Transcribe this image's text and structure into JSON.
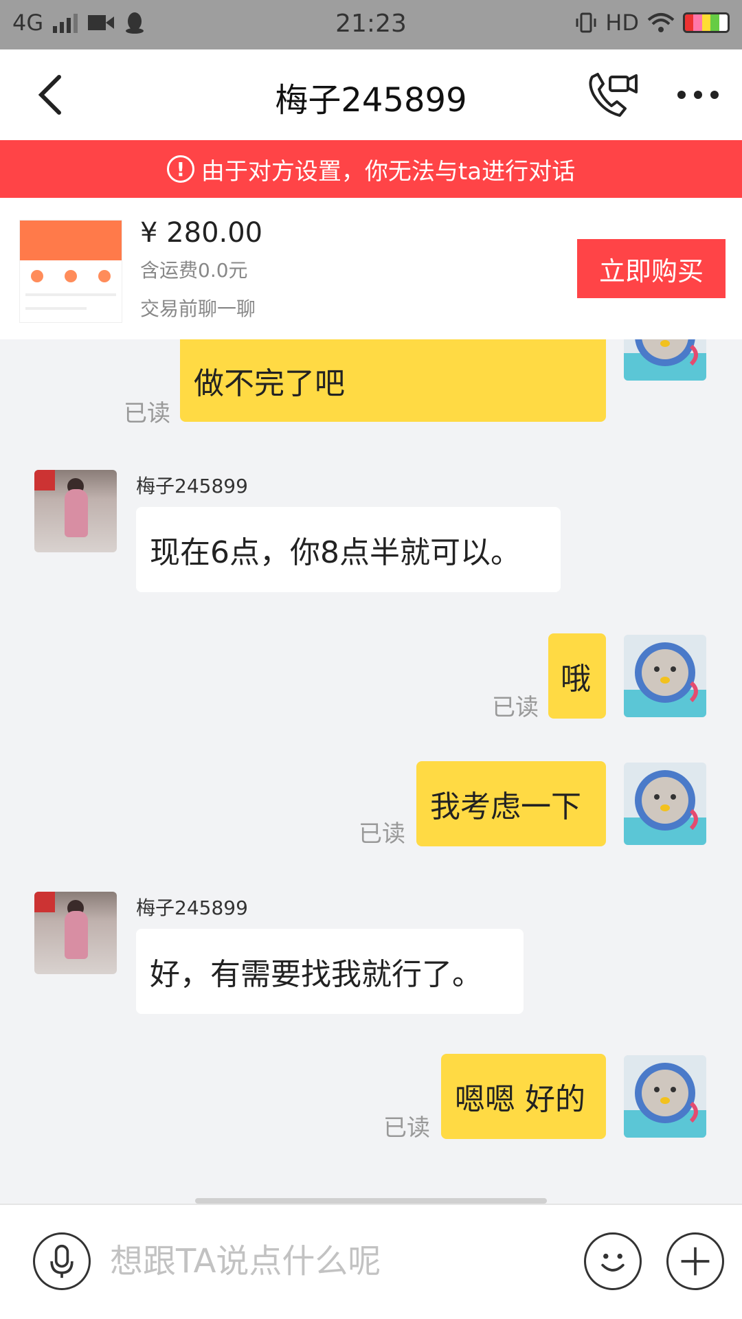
{
  "status_bar": {
    "network": "4G",
    "time": "21:23",
    "hd": "HD"
  },
  "header": {
    "title": "梅子245899"
  },
  "banner": {
    "text": "由于对方设置，你无法与ta进行对话"
  },
  "product": {
    "price": "¥ 280.00",
    "shipping": "含运费0.0元",
    "chat_hint": "交易前聊一聊",
    "buy_label": "立即购买"
  },
  "messages": [
    {
      "from": "me",
      "text": "做不完了吧",
      "read": "已读"
    },
    {
      "from": "them",
      "name": "梅子245899",
      "text": "现在6点，你8点半就可以。"
    },
    {
      "from": "me",
      "text": "哦",
      "read": "已读"
    },
    {
      "from": "me",
      "text": "我考虑一下",
      "read": "已读"
    },
    {
      "from": "them",
      "name": "梅子245899",
      "text": "好，有需要找我就行了。"
    },
    {
      "from": "me",
      "text": "嗯嗯 好的",
      "read": "已读"
    }
  ],
  "composer": {
    "placeholder": "想跟TA说点什么呢"
  },
  "colors": {
    "accent_red": "#ff4447",
    "my_bubble": "#ffda44",
    "their_bubble": "#ffffff",
    "background": "#f2f3f5"
  }
}
